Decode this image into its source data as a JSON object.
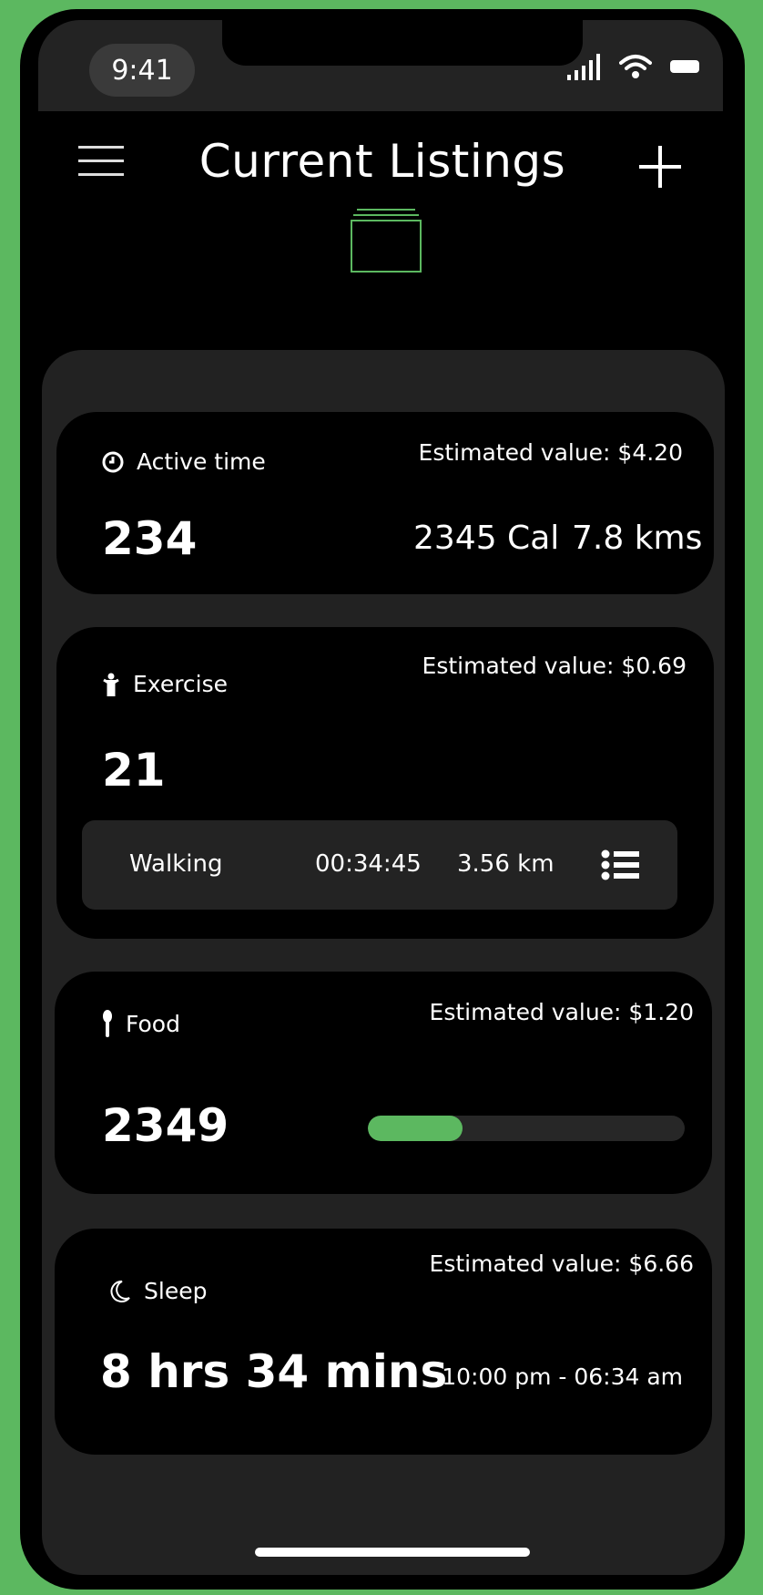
{
  "status_bar": {
    "time": "9:41"
  },
  "header": {
    "title": "Current Listings"
  },
  "cards": {
    "active_time": {
      "label": "Active time",
      "estimated_value": "Estimated value: $4.20",
      "value": "234",
      "calories": "2345 Cal",
      "distance": "7.8 kms"
    },
    "exercise": {
      "label": "Exercise",
      "estimated_value": "Estimated value: $0.69",
      "value": "21",
      "activity": {
        "name": "Walking",
        "duration": "00:34:45",
        "distance": "3.56 km"
      }
    },
    "food": {
      "label": "Food",
      "estimated_value": "Estimated value: $1.20",
      "value": "2349",
      "progress_fraction": 0.3
    },
    "sleep": {
      "label": "Sleep",
      "estimated_value": "Estimated value: $6.66",
      "value": "8 hrs 34 mins",
      "range": "10:00 pm - 06:34 am"
    }
  },
  "colors": {
    "accent": "#5cb860",
    "panel": "#222222",
    "card": "#000000"
  },
  "icons": [
    "menu-icon",
    "plus-icon",
    "stack-icon",
    "clock-icon",
    "person-icon",
    "spoon-icon",
    "moon-icon",
    "list-icon",
    "signal-icon",
    "wifi-icon",
    "battery-icon"
  ]
}
